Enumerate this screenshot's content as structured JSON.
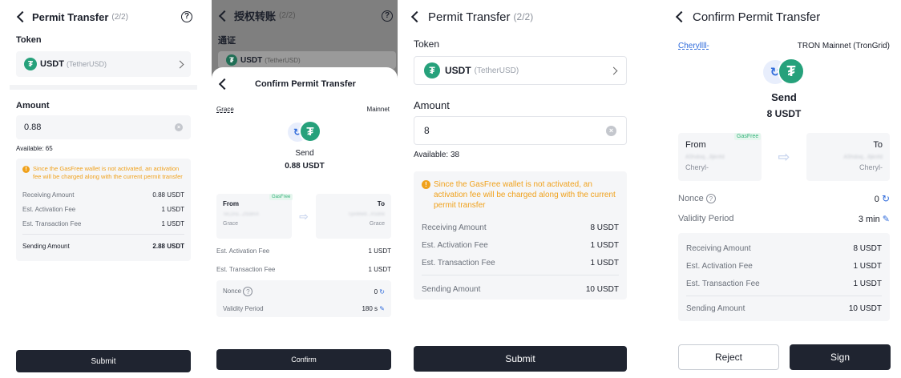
{
  "panel1": {
    "title": "Permit Transfer",
    "step": "(2/2)",
    "token_label": "Token",
    "token_symbol": "USDT",
    "token_name": "(TetherUSD)",
    "amount_label": "Amount",
    "amount_value": "0.88",
    "available": "Available: 65",
    "warning": "Since the GasFree wallet is not activated, an activation fee will be charged along with the current permit transfer",
    "rows": [
      {
        "label": "Receiving Amount",
        "value": "0.88 USDT"
      },
      {
        "label": "Est. Activation Fee",
        "value": "1 USDT"
      },
      {
        "label": "Est. Transaction Fee",
        "value": "1 USDT"
      }
    ],
    "sending_label": "Sending Amount",
    "sending_value": "2.88 USDT",
    "submit": "Submit"
  },
  "panel2": {
    "bg_title": "授权转账",
    "bg_step": "(2/2)",
    "bg_token_label": "通证",
    "bg_token_symbol": "USDT",
    "bg_token_name": "(TetherUSD)",
    "sheet_title": "Confirm Permit Transfer",
    "account": "Grace",
    "network": "Mainnet",
    "send_label": "Send",
    "send_amount": "0.88 USDT",
    "gasfree": "GasFree",
    "from_label": "From",
    "to_label": "To",
    "from_addr": "TeLDra...ZfzdmX",
    "to_addr": "TpxWw9...XSdnk",
    "from_name": "Grace",
    "to_name": "Grace",
    "rows": [
      {
        "label": "Est. Activation Fee",
        "value": "1 USDT"
      },
      {
        "label": "Est. Transaction Fee",
        "value": "1 USDT"
      }
    ],
    "nonce_label": "Nonce",
    "nonce_value": "0",
    "validity_label": "Validity Period",
    "validity_value": "180 s",
    "confirm": "Confirm"
  },
  "panel3": {
    "title": "Permit Transfer",
    "step": "(2/2)",
    "token_label": "Token",
    "token_symbol": "USDT",
    "token_name": "(TetherUSD)",
    "amount_label": "Amount",
    "amount_value": "8",
    "available": "Available: 38",
    "warning": "Since the GasFree wallet is not activated, an activation fee will be charged along with the current permit transfer",
    "rows": [
      {
        "label": "Receiving Amount",
        "value": "8 USDT"
      },
      {
        "label": "Est. Activation Fee",
        "value": "1 USDT"
      },
      {
        "label": "Est. Transaction Fee",
        "value": "1 USDT"
      }
    ],
    "sending_label": "Sending Amount",
    "sending_value": "10 USDT",
    "submit": "Submit"
  },
  "panel4": {
    "title": "Confirm Permit Transfer",
    "account": "Cheryllll-",
    "network": "TRON Mainnet (TronGrid)",
    "send_label": "Send",
    "send_amount": "8 USDT",
    "gasfree": "GasFree",
    "from_label": "From",
    "to_label": "To",
    "from_addr": "A5hdoq...8jknfd",
    "to_addr": "A5hdoq...8jknfd",
    "from_name": "Cheryl-",
    "to_name": "Cheryl-",
    "nonce_label": "Nonce",
    "nonce_value": "0",
    "validity_label": "Validity Period",
    "validity_value": "3 min",
    "rows": [
      {
        "label": "Receiving Amount",
        "value": "8 USDT"
      },
      {
        "label": "Est. Activation Fee",
        "value": "1 USDT"
      },
      {
        "label": "Est. Transaction Fee",
        "value": "1 USDT"
      }
    ],
    "sending_label": "Sending Amount",
    "sending_value": "10 USDT",
    "reject": "Reject",
    "sign": "Sign"
  },
  "colors": {
    "accent_dark": "#1f2430",
    "tether_green": "#26a17b",
    "warning_orange": "#f0a11b",
    "link_blue": "#2f6bdb"
  }
}
